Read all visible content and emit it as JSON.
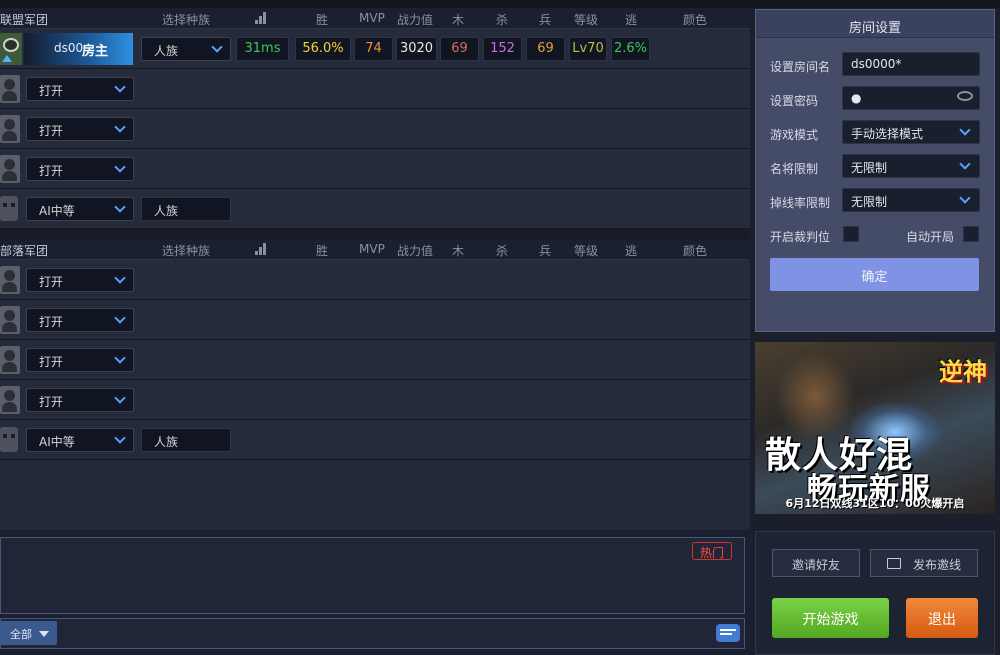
{
  "teams": [
    {
      "name": "联盟军团",
      "headers": {
        "race": "选择种族",
        "win": "胜",
        "mvp": "MVP",
        "power": "战力值",
        "wood": "木",
        "kill": "杀",
        "soldier": "兵",
        "level": "等级",
        "escape": "逃",
        "color": "颜色"
      }
    },
    {
      "name": "部落军团",
      "headers": {
        "race": "选择种族",
        "win": "胜",
        "mvp": "MVP",
        "power": "战力值",
        "wood": "木",
        "kill": "杀",
        "soldier": "兵",
        "level": "等级",
        "escape": "逃",
        "color": "颜色"
      }
    }
  ],
  "host_player": {
    "name": "ds00",
    "badge": "房主",
    "race": "人族",
    "ping": "31ms",
    "win_rate": "56.0%",
    "mvp": "74",
    "power": "3020",
    "wood": "69",
    "kill": "152",
    "soldier": "69",
    "level": "Lv70",
    "escape": "2.6%"
  },
  "slots": {
    "open_label": "打开",
    "ai_label": "AI中等",
    "ai_race": "人族"
  },
  "room_settings": {
    "title": "房间设置",
    "room_name_label": "设置房间名",
    "room_name_value": "ds0000*",
    "password_label": "设置密码",
    "password_value": "●",
    "mode_label": "游戏模式",
    "mode_value": "手动选择模式",
    "hero_label": "名将限制",
    "hero_value": "无限制",
    "drop_label": "掉线率限制",
    "drop_value": "无限制",
    "referee_label": "开启裁判位",
    "autostart_label": "自动开局",
    "confirm_label": "确定"
  },
  "ad": {
    "logo": "逆神",
    "line1": "散人好混",
    "line2": "畅玩新服",
    "line3": "6月12日双线31区10：00火爆开启"
  },
  "chat": {
    "hot_label": "热门",
    "all_label": "全部"
  },
  "actions": {
    "invite_label": "邀请好友",
    "publish_label": "发布邀线",
    "start_label": "开始游戏",
    "exit_label": "退出"
  },
  "colors": {
    "ping": "#3fc45a",
    "win_rate": "#f3d23a",
    "mvp": "#f0903a",
    "power": "#e8e8e8",
    "wood": "#e06a5a",
    "kill": "#c070e0",
    "soldier": "#e0a040",
    "level": "#b5c23a",
    "escape": "#3fc45a"
  }
}
